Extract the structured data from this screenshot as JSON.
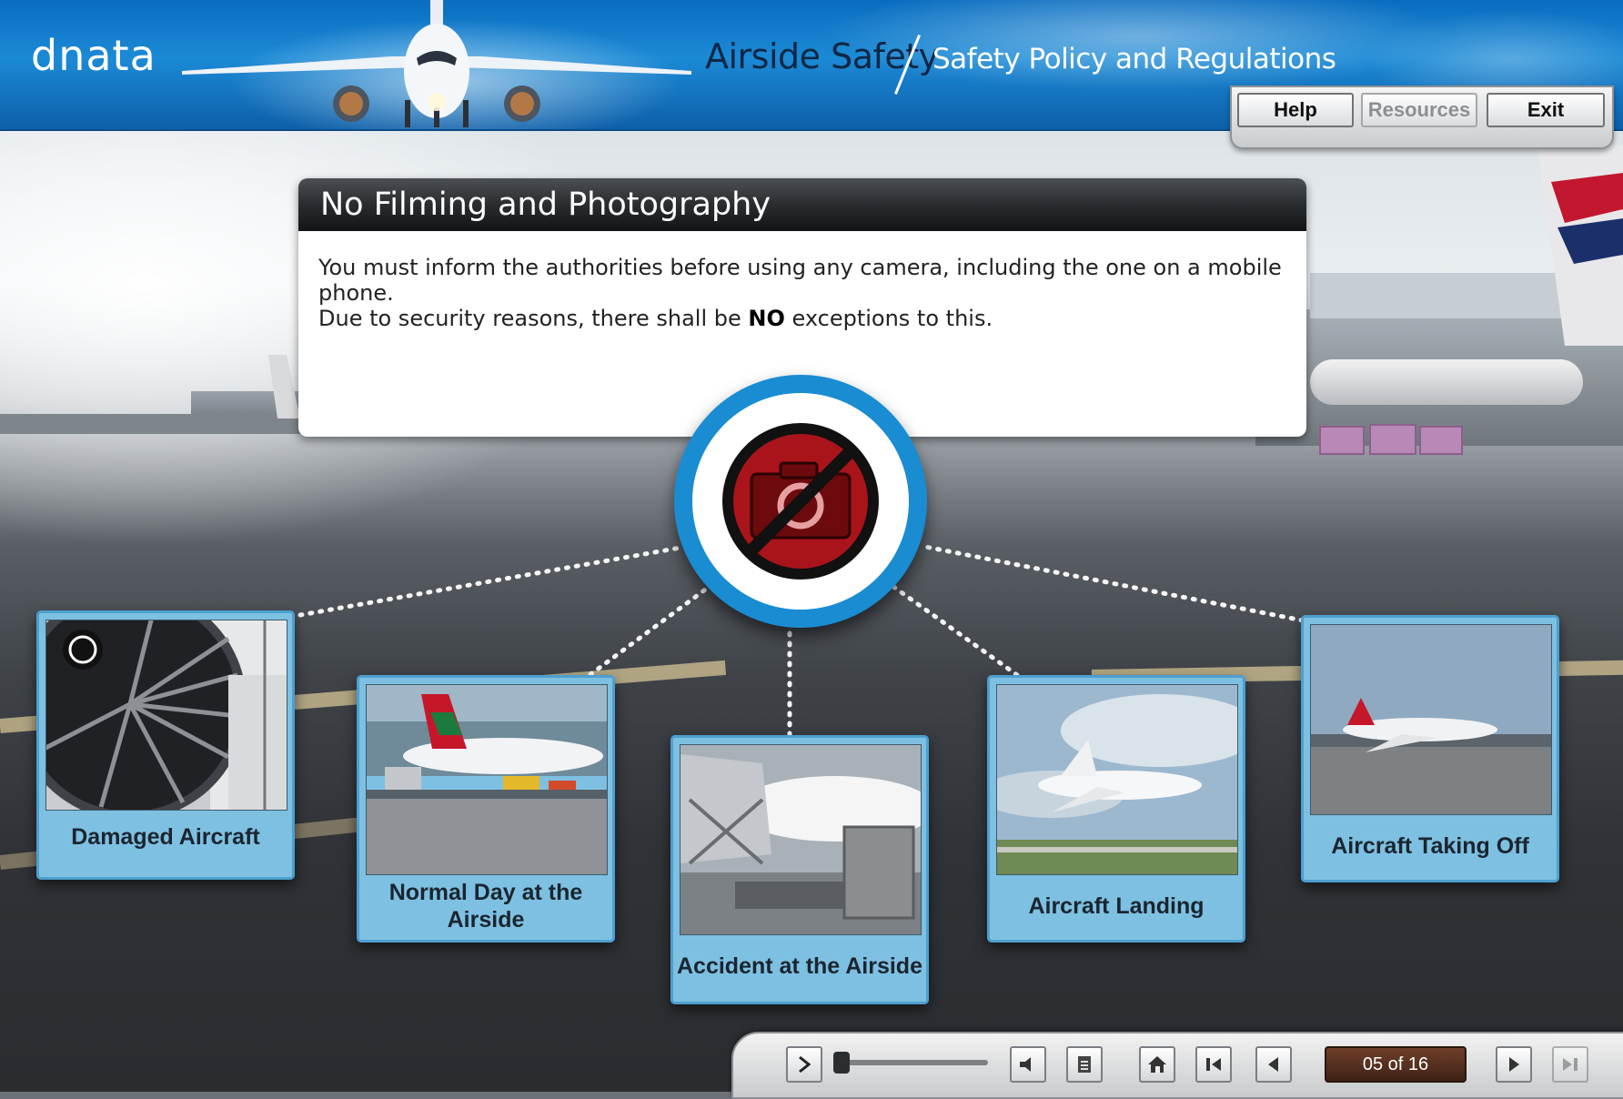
{
  "header": {
    "logo": "dnata",
    "course_title": "Airside Safety",
    "module_title": "Safety Policy and Regulations"
  },
  "top_buttons": {
    "help": "Help",
    "resources": "Resources",
    "exit": "Exit"
  },
  "panel": {
    "title": "No Filming and Photography",
    "line1": "You must inform the authorities before using any camera, including the one on a mobile phone.",
    "line2_before": "Due to security reasons, there shall be ",
    "line2_bold": "NO",
    "line2_after": " exceptions to this."
  },
  "center_icon": "no-camera-icon",
  "cards": [
    {
      "label": "Damaged Aircraft"
    },
    {
      "label": "Normal Day at the Airside"
    },
    {
      "label": "Accident at the Airside"
    },
    {
      "label": "Aircraft Landing"
    },
    {
      "label": "Aircraft Taking Off"
    }
  ],
  "controls": {
    "page_indicator": "05 of 16",
    "seek_progress": 0.0
  },
  "colors": {
    "header_blue": "#1b8ad6",
    "card_blue": "#7ec0e1",
    "hub_blue": "#1a8cd2",
    "no_sign_red": "#a8141a"
  }
}
